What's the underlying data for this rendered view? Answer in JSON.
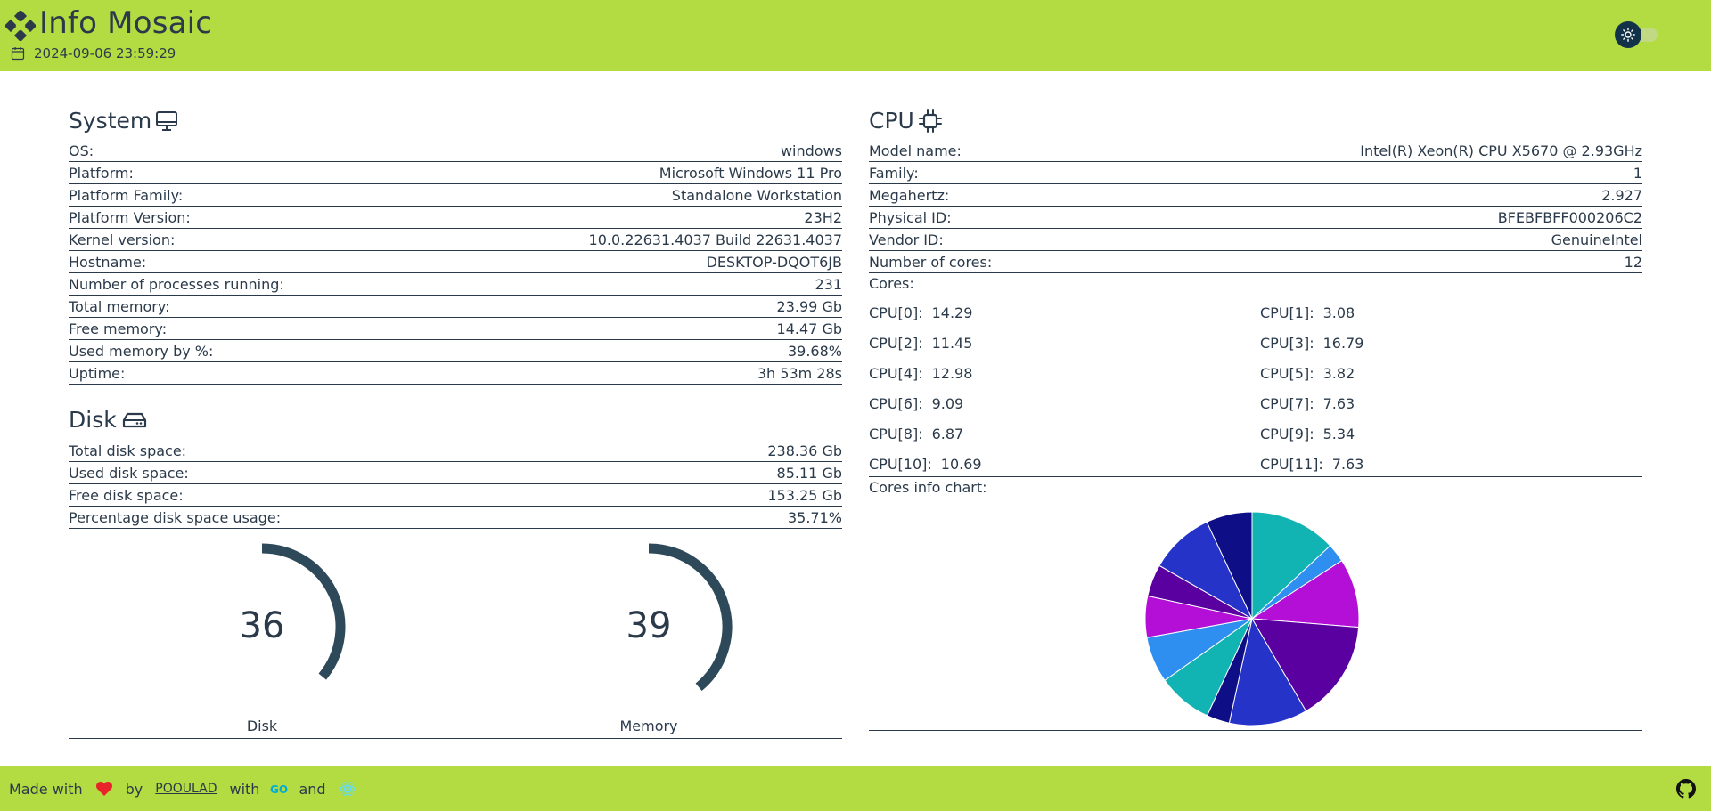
{
  "header": {
    "title": "Info Mosaic",
    "datetime": "2024-09-06 23:59:29",
    "brand_color": "#b2dc41",
    "theme_toggle_icon": "sun-icon"
  },
  "system": {
    "title": "System",
    "icon": "monitor-icon",
    "rows": [
      {
        "label": "OS:",
        "value": "windows"
      },
      {
        "label": "Platform:",
        "value": "Microsoft Windows 11 Pro"
      },
      {
        "label": "Platform Family:",
        "value": "Standalone Workstation"
      },
      {
        "label": "Platform Version:",
        "value": "23H2"
      },
      {
        "label": "Kernel version:",
        "value": "10.0.22631.4037 Build 22631.4037"
      },
      {
        "label": "Hostname:",
        "value": "DESKTOP-DQOT6JB"
      },
      {
        "label": "Number of processes running:",
        "value": "231"
      },
      {
        "label": "Total memory:",
        "value": "23.99 Gb"
      },
      {
        "label": "Free memory:",
        "value": "14.47 Gb"
      },
      {
        "label": "Used memory by %:",
        "value": "39.68%"
      },
      {
        "label": "Uptime:",
        "value": "3h 53m 28s"
      }
    ]
  },
  "disk": {
    "title": "Disk",
    "icon": "hard-drive-icon",
    "rows": [
      {
        "label": "Total disk space:",
        "value": "238.36 Gb"
      },
      {
        "label": "Used disk space:",
        "value": "85.11 Gb"
      },
      {
        "label": "Free disk space:",
        "value": "153.25 Gb"
      },
      {
        "label": "Percentage disk space usage:",
        "value": "35.71%"
      }
    ],
    "gauges": [
      {
        "label": "Disk",
        "value": "36",
        "percent": 36
      },
      {
        "label": "Memory",
        "value": "39",
        "percent": 39
      }
    ],
    "gauge_color": "#2e4a5a"
  },
  "cpu": {
    "title": "CPU",
    "icon": "cpu-chip-icon",
    "rows": [
      {
        "label": "Model name:",
        "value": "Intel(R) Xeon(R) CPU X5670 @ 2.93GHz"
      },
      {
        "label": "Family:",
        "value": "1"
      },
      {
        "label": "Megahertz:",
        "value": "2.927"
      },
      {
        "label": "Physical ID:",
        "value": "BFEBFBFF000206C2"
      },
      {
        "label": "Vendor ID:",
        "value": "GenuineIntel"
      },
      {
        "label": "Number of cores:",
        "value": "12"
      }
    ],
    "cores_label": "Cores:",
    "cores": [
      {
        "name": "CPU[0]:",
        "value": "14.29"
      },
      {
        "name": "CPU[1]:",
        "value": "3.08"
      },
      {
        "name": "CPU[2]:",
        "value": "11.45"
      },
      {
        "name": "CPU[3]:",
        "value": "16.79"
      },
      {
        "name": "CPU[4]:",
        "value": "12.98"
      },
      {
        "name": "CPU[5]:",
        "value": "3.82"
      },
      {
        "name": "CPU[6]:",
        "value": "9.09"
      },
      {
        "name": "CPU[7]:",
        "value": "7.63"
      },
      {
        "name": "CPU[8]:",
        "value": "6.87"
      },
      {
        "name": "CPU[9]:",
        "value": "5.34"
      },
      {
        "name": "CPU[10]:",
        "value": "10.69"
      },
      {
        "name": "CPU[11]:",
        "value": "7.63"
      }
    ],
    "chart_label": "Cores info chart:"
  },
  "chart_data": {
    "type": "pie",
    "categories": [
      "CPU[0]",
      "CPU[1]",
      "CPU[2]",
      "CPU[3]",
      "CPU[4]",
      "CPU[5]",
      "CPU[6]",
      "CPU[7]",
      "CPU[8]",
      "CPU[9]",
      "CPU[10]",
      "CPU[11]"
    ],
    "values": [
      14.29,
      3.08,
      11.45,
      16.79,
      12.98,
      3.82,
      9.09,
      7.63,
      6.87,
      5.34,
      10.69,
      7.63
    ],
    "colors": [
      "#12b3b3",
      "#2f8ff0",
      "#b40fd6",
      "#5a00a0",
      "#2633c8",
      "#0e0e86",
      "#12b3b3",
      "#2f8ff0",
      "#b40fd6",
      "#5a00a0",
      "#2633c8",
      "#0e0e86"
    ],
    "legend": "none"
  },
  "footer": {
    "made_with": "Made with",
    "by": "by",
    "author": "POOULAD",
    "with": "with",
    "and": "and",
    "heart_icon": "heart-icon",
    "go_icon": "go-logo-icon",
    "react_icon": "react-logo-icon",
    "github_icon": "github-icon"
  }
}
